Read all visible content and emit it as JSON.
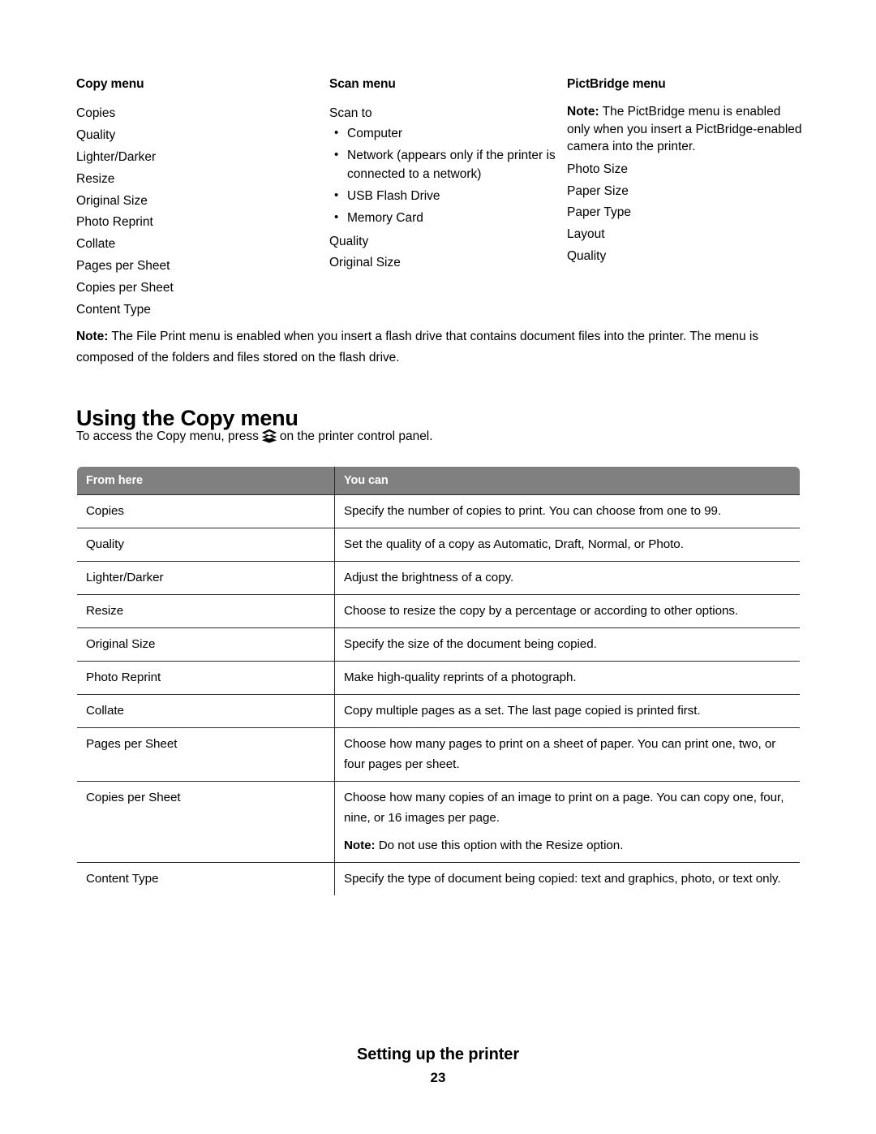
{
  "menu_columns": {
    "copy": {
      "heading": "Copy menu",
      "items": [
        "Copies",
        "Quality",
        "Lighter/Darker",
        "Resize",
        "Original Size",
        "Photo Reprint",
        "Collate",
        "Pages per Sheet",
        "Copies per Sheet",
        "Content Type"
      ]
    },
    "scan": {
      "heading": "Scan menu",
      "scan_to_label": "Scan to",
      "scan_to_options": [
        "Computer",
        "Network (appears only if the printer is connected to a network)",
        "USB Flash Drive",
        "Memory Card"
      ],
      "trailing_items": [
        "Quality",
        "Original Size"
      ]
    },
    "pictbridge": {
      "heading": "PictBridge menu",
      "note_label": "Note:",
      "note_text": " The PictBridge menu is enabled only when you insert a PictBridge-enabled camera into the printer.",
      "items": [
        "Photo Size",
        "Paper Size",
        "Paper Type",
        "Layout",
        "Quality"
      ]
    }
  },
  "file_print_note": {
    "label": "Note:",
    "text": " The File Print menu is enabled when you insert a flash drive that contains document files into the printer. The menu is composed of the folders and files stored on the flash drive."
  },
  "section": {
    "heading": "Using the Copy menu",
    "intro_before": "To access the Copy menu, press",
    "intro_icon": "copy-stack-icon",
    "intro_after": "on the printer control panel."
  },
  "table": {
    "headers": [
      "From here",
      "You can"
    ],
    "header_bg": "#808080",
    "header_text_color": "#ffffff",
    "border_color": "#2b2b2b",
    "rows": [
      {
        "from_here": "Copies",
        "you_can": [
          "Specify the number of copies to print. You can choose from one to 99."
        ]
      },
      {
        "from_here": "Quality",
        "you_can": [
          "Set the quality of a copy as Automatic, Draft, Normal, or Photo."
        ]
      },
      {
        "from_here": "Lighter/Darker",
        "you_can": [
          "Adjust the brightness of a copy."
        ]
      },
      {
        "from_here": "Resize",
        "you_can": [
          "Choose to resize the copy by a percentage or according to other options."
        ]
      },
      {
        "from_here": "Original Size",
        "you_can": [
          "Specify the size of the document being copied."
        ]
      },
      {
        "from_here": "Photo Reprint",
        "you_can": [
          "Make high-quality reprints of a photograph."
        ]
      },
      {
        "from_here": "Collate",
        "you_can": [
          "Copy multiple pages as a set. The last page copied is printed first."
        ]
      },
      {
        "from_here": "Pages per Sheet",
        "you_can": [
          "Choose how many pages to print on a sheet of paper. You can print one, two, or four pages per sheet."
        ]
      },
      {
        "from_here": "Copies per Sheet",
        "you_can": [
          "Choose how many copies of an image to print on a page. You can copy one, four, nine, or 16 images per page."
        ],
        "note_label": "Note:",
        "note_text": " Do not use this option with the Resize option."
      },
      {
        "from_here": "Content Type",
        "you_can": [
          "Specify the type of document being copied: text and graphics, photo, or text only."
        ]
      }
    ]
  },
  "footer": {
    "title": "Setting up the printer",
    "page_number": "23"
  }
}
